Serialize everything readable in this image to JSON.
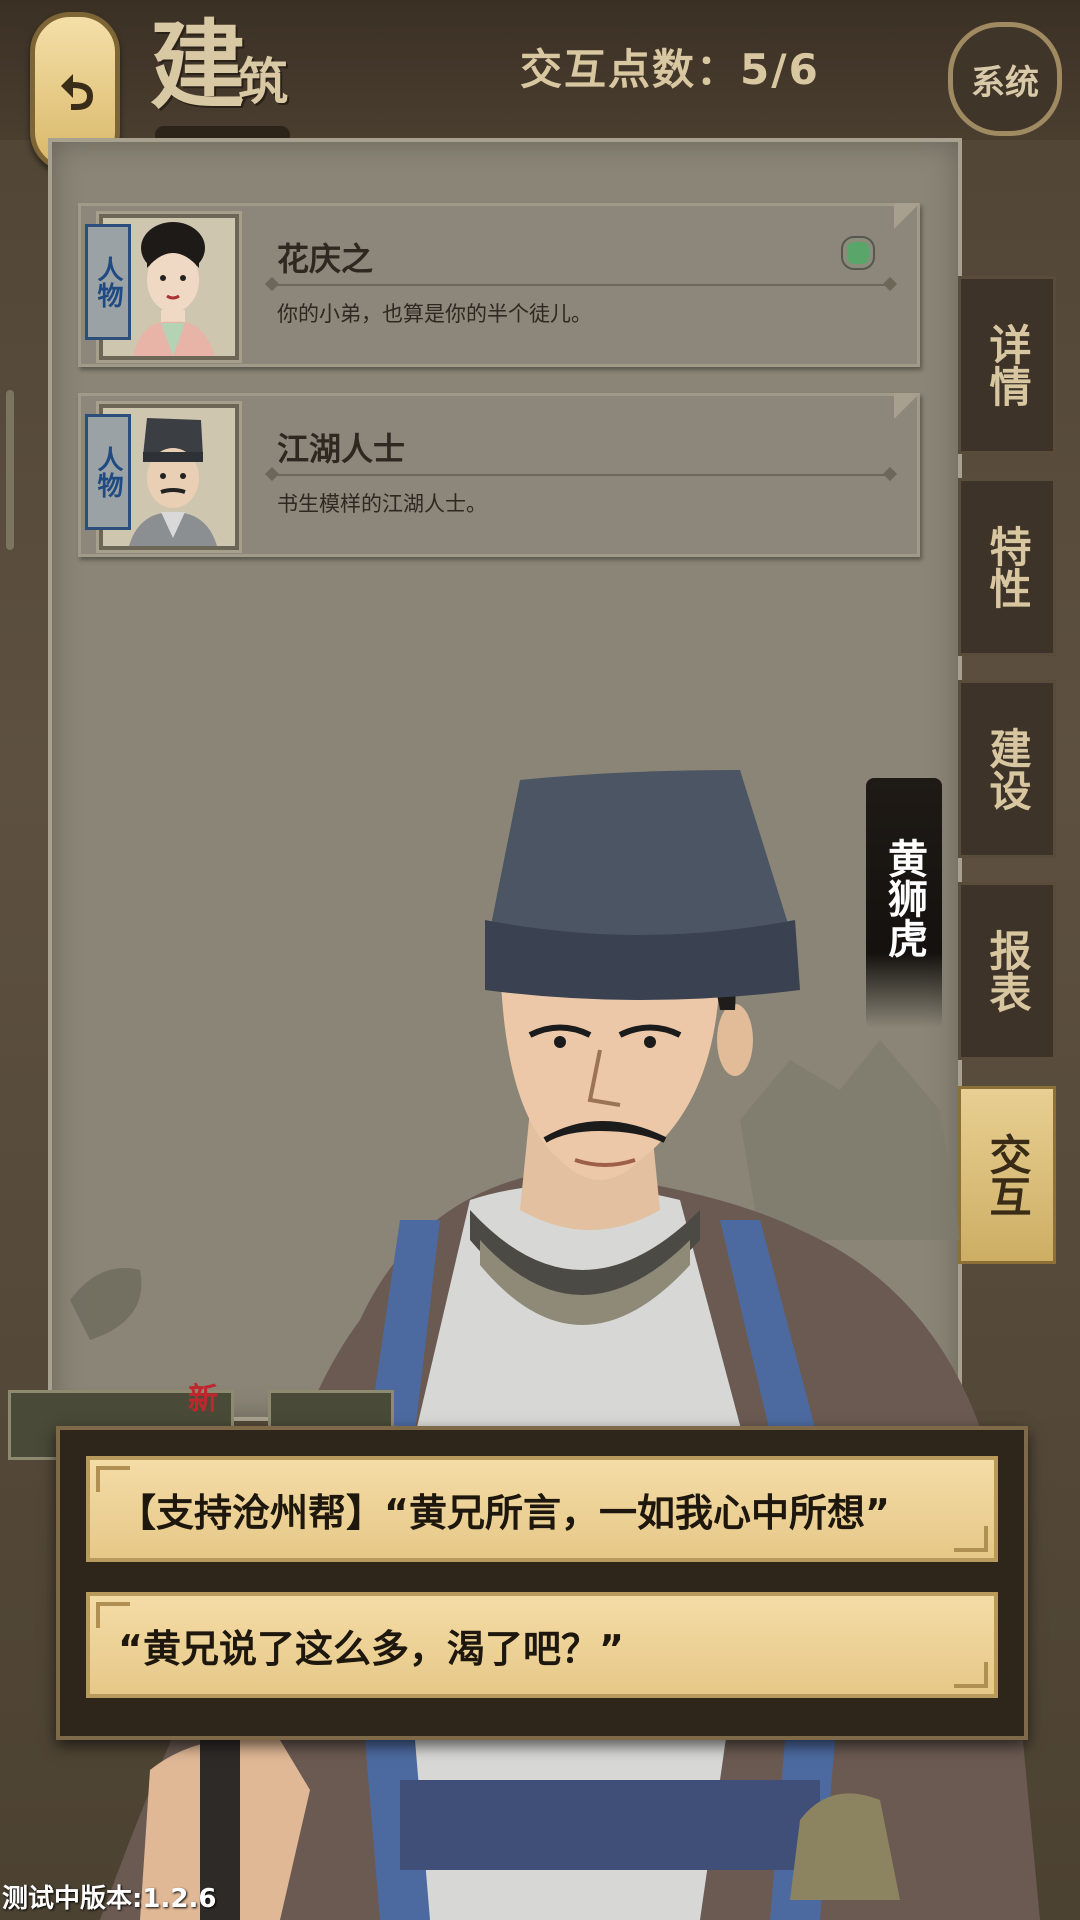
{
  "header": {
    "back_icon": "undo-arrow-icon",
    "title_big": "建",
    "title_small": "筑",
    "points_label": "交互点数：5/6",
    "system_label": "系统"
  },
  "list": {
    "cards": [
      {
        "tag": "人物",
        "name": "花庆之",
        "desc": "你的小弟，也算是你的半个徒儿。",
        "has_dot": true
      },
      {
        "tag": "人物",
        "name": "江湖人士",
        "desc": "书生模样的江湖人士。",
        "has_dot": false
      }
    ]
  },
  "side_tabs": [
    {
      "label": "详情",
      "active": false
    },
    {
      "label": "特性",
      "active": false
    },
    {
      "label": "建设",
      "active": false
    },
    {
      "label": "报表",
      "active": false
    },
    {
      "label": "交互",
      "active": true
    }
  ],
  "npc": {
    "name": "黄狮虎"
  },
  "bottom": {
    "new_badge": "新"
  },
  "dialog": {
    "options": [
      "【支持沧州帮】“黄兄所言，一如我心中所想”",
      "“黄兄说了这么多，渴了吧？”"
    ]
  },
  "version": "测试中版本:1.2.6",
  "colors": {
    "accent_gold": "#e6c888",
    "panel": "#8a8576",
    "dark": "#3d3328"
  }
}
